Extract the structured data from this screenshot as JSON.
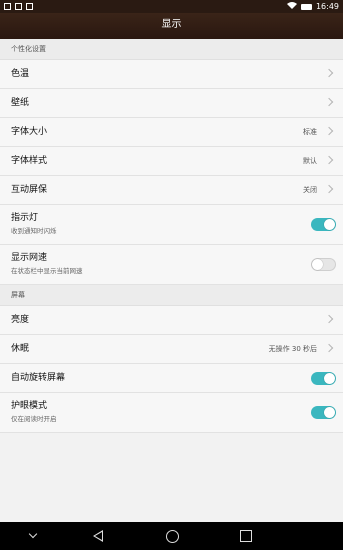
{
  "status_bar": {
    "time": "16:49",
    "icons": [
      "notification-icon",
      "wifi-icon",
      "battery-icon"
    ]
  },
  "title": "显示",
  "sections": [
    {
      "header": "个性化设置",
      "rows": [
        {
          "label": "色温"
        },
        {
          "label": "壁纸"
        },
        {
          "label": "字体大小",
          "value": "标准"
        },
        {
          "label": "字体样式",
          "value": "默认"
        },
        {
          "label": "互动屏保",
          "value": "关闭"
        },
        {
          "label": "指示灯",
          "sub": "收到通知时闪烁",
          "toggle": true
        },
        {
          "label": "显示网速",
          "sub": "在状态栏中显示当前网速",
          "toggle": false
        }
      ]
    },
    {
      "header": "屏幕",
      "rows": [
        {
          "label": "亮度"
        },
        {
          "label": "休眠",
          "value": "无操作 30 秒后"
        },
        {
          "label": "自动旋转屏幕",
          "toggle": true
        },
        {
          "label": "护眼模式",
          "sub": "仅在阅读时开启",
          "toggle": true
        }
      ]
    }
  ],
  "colors": {
    "accent": "#3bb7bf",
    "title_bar": "#2a1710"
  }
}
